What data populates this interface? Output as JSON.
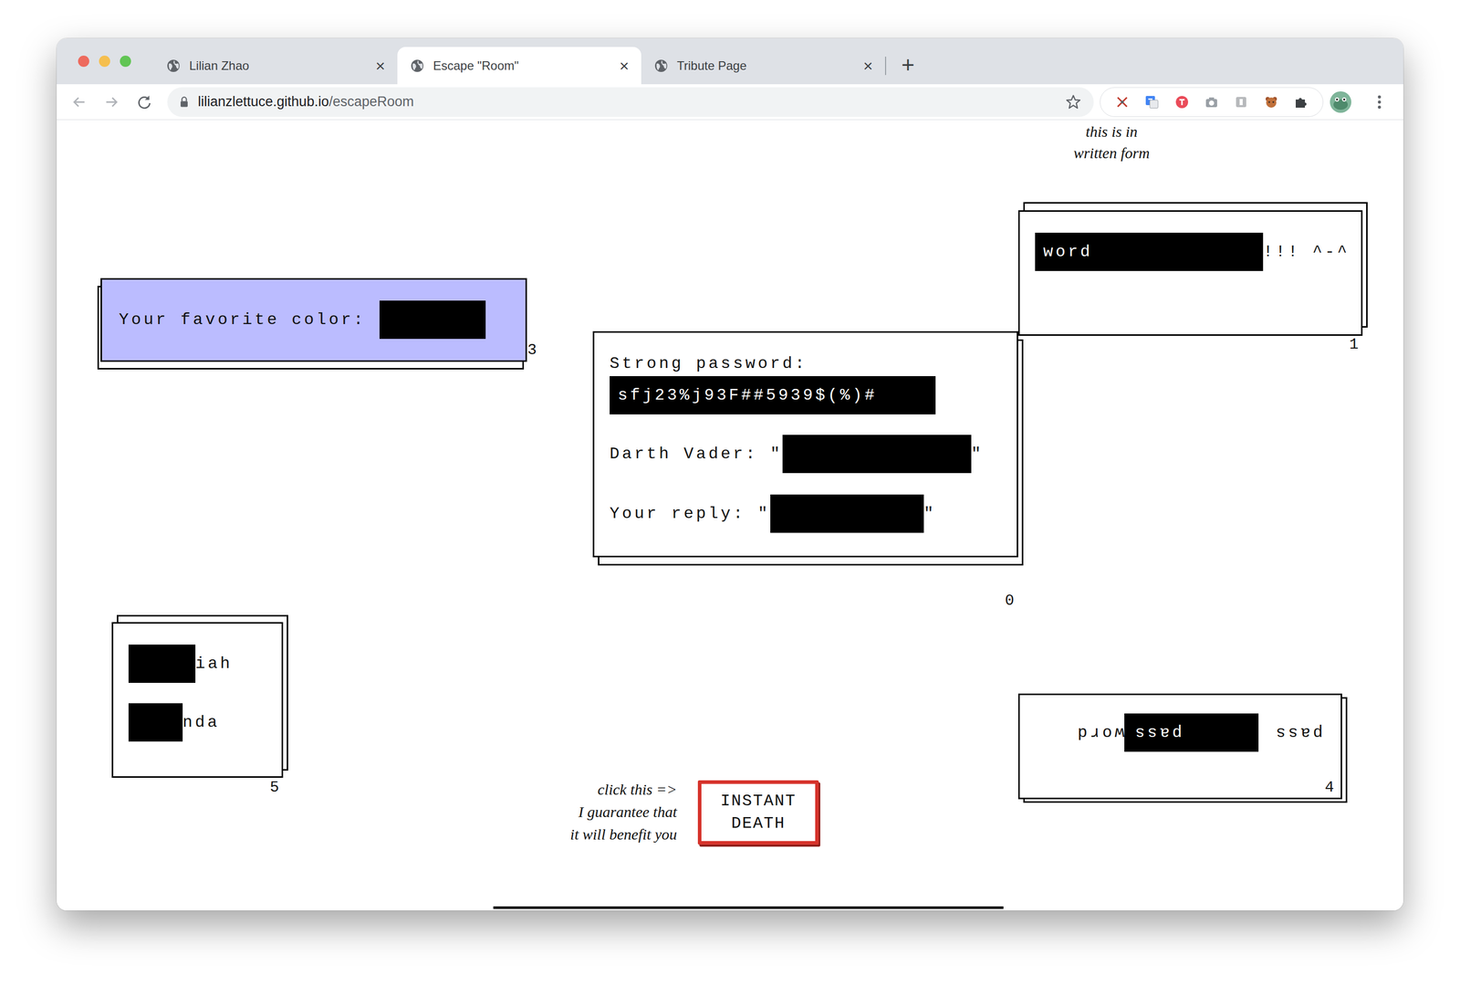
{
  "window": {
    "tabs": [
      {
        "label": "Lilian Zhao",
        "selected": false,
        "close": "×"
      },
      {
        "label": "Escape \"Room\"",
        "selected": true,
        "close": "×"
      },
      {
        "label": "Tribute Page",
        "selected": false,
        "close": "×"
      }
    ],
    "new_tab": "+",
    "address": {
      "domain": "lilianzlettuce.github.io",
      "path": "/escapeRoom"
    }
  },
  "page": {
    "note": [
      "this is in",
      "written form"
    ],
    "puzzles": [
      {
        "number": "1",
        "color": "#ffffff",
        "flipped": false,
        "rows": [
          [
            {
              "kind": "field",
              "text": "word"
            },
            {
              "kind": "text",
              "text": "!!! ^-^"
            }
          ]
        ]
      },
      {
        "number": "3",
        "color": "#bbbcff",
        "flipped": false,
        "rows": [
          [
            {
              "kind": "text",
              "text": "Your favorite color:"
            },
            {
              "kind": "field",
              "text": ""
            }
          ]
        ]
      },
      {
        "number": "0",
        "color": "#ffffff",
        "flipped": false,
        "rows": [
          [
            {
              "kind": "text",
              "text": "Strong password:"
            }
          ],
          [
            {
              "kind": "field",
              "text": "sfj23%j93F##5939$(%)#"
            }
          ],
          [
            {
              "kind": "text",
              "text": "Darth Vader: \""
            },
            {
              "kind": "field",
              "text": ""
            },
            {
              "kind": "text",
              "text": "\""
            }
          ],
          [
            {
              "kind": "text",
              "text": "Your reply: \""
            },
            {
              "kind": "field",
              "text": ""
            },
            {
              "kind": "text",
              "text": "\""
            }
          ]
        ]
      },
      {
        "number": "5",
        "color": "#ffffff",
        "flipped": false,
        "rows": [
          [
            {
              "kind": "field",
              "text": ""
            },
            {
              "kind": "text",
              "text": "iah"
            }
          ],
          [
            {
              "kind": "field",
              "text": ""
            },
            {
              "kind": "text",
              "text": "nda"
            }
          ]
        ]
      },
      {
        "number": "4",
        "color": "#ffffff",
        "flipped": true,
        "rows": [
          [
            {
              "kind": "text",
              "text": "pass"
            },
            {
              "kind": "field",
              "text": "pass"
            },
            {
              "kind": "text",
              "text": "word"
            }
          ]
        ]
      }
    ],
    "death_note": [
      "click this =>",
      "I guarantee that",
      "it will benefit you"
    ],
    "death_button": "INSTANT DEATH"
  }
}
